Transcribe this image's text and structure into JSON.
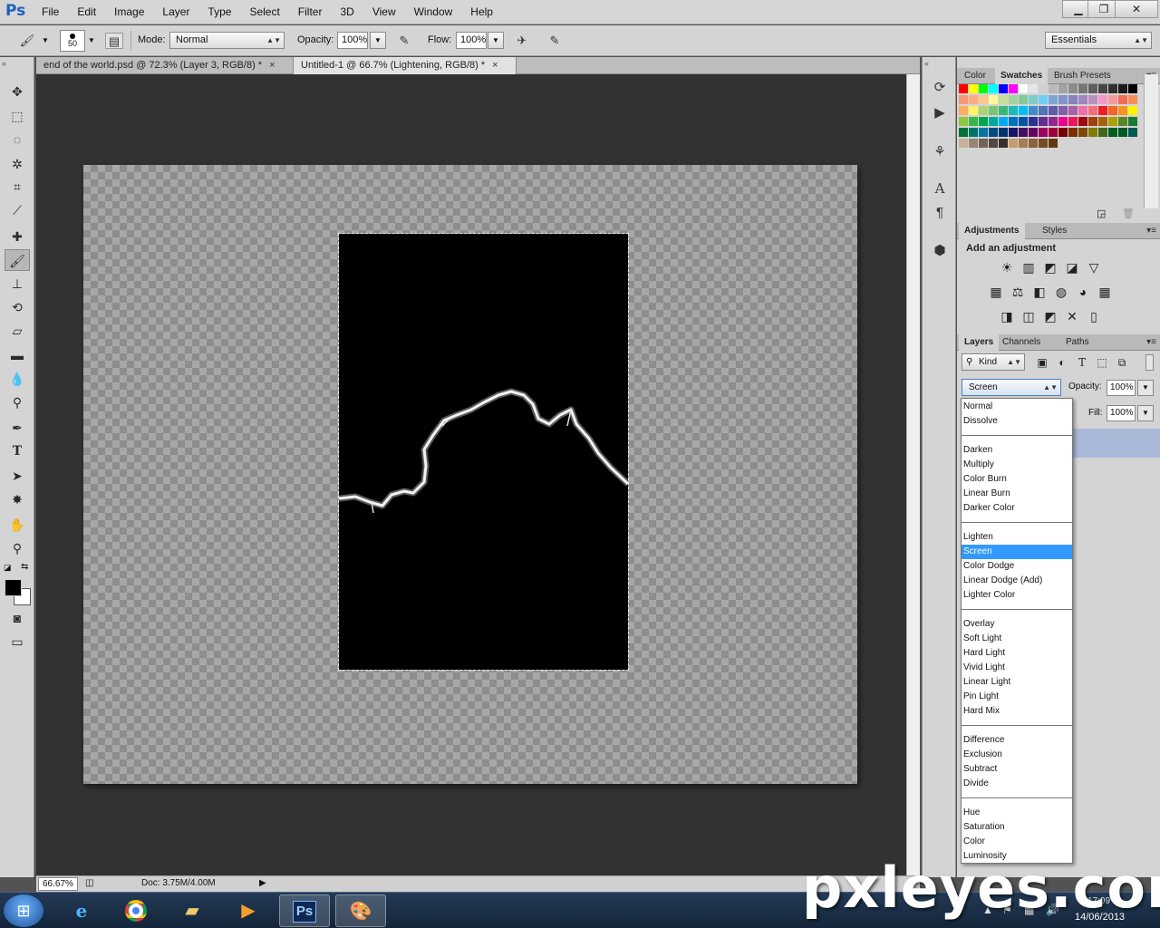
{
  "app": {
    "logo": "Ps"
  },
  "menu": [
    "File",
    "Edit",
    "Image",
    "Layer",
    "Type",
    "Select",
    "Filter",
    "3D",
    "View",
    "Window",
    "Help"
  ],
  "window_controls": {
    "minimize": "▁",
    "maximize": "❐",
    "close": "✕"
  },
  "options": {
    "brush_size": "50",
    "mode_label": "Mode:",
    "mode_value": "Normal",
    "opacity_label": "Opacity:",
    "opacity_value": "100%",
    "flow_label": "Flow:",
    "flow_value": "100%",
    "workspace": "Essentials"
  },
  "doc_tabs": [
    {
      "label": "end of the world.psd @ 72.3% (Layer 3, RGB/8) *",
      "close": "×"
    },
    {
      "label": "Untitled-1 @ 66.7% (Lightening, RGB/8) *",
      "close": "×"
    }
  ],
  "status": {
    "zoom": "66.67%",
    "doc": "Doc: 3.75M/4.00M"
  },
  "panels": {
    "color_tabs": [
      "Color",
      "Swatches",
      "Brush Presets"
    ],
    "adjust_tabs": [
      "Adjustments",
      "Styles"
    ],
    "adjust_title": "Add an adjustment",
    "layers_tabs": [
      "Layers",
      "Channels",
      "Paths"
    ],
    "kind": "Kind",
    "blend_value": "Screen",
    "opacity_label": "Opacity:",
    "opacity_value": "100%",
    "fill_label": "Fill:",
    "fill_value": "100%"
  },
  "swatch_rows": [
    [
      "#ff0000",
      "#ffff00",
      "#00ff00",
      "#00ffff",
      "#0000ff",
      "#ff00ff",
      "#ffffff",
      "#e6e6e6",
      "#d0d0d0",
      "#bababa",
      "#a3a3a3",
      "#8c8c8c",
      "#757575",
      "#5e5e5e",
      "#474747",
      "#303030",
      "#1a1a1a",
      "#000000"
    ],
    [
      "#f7977a",
      "#f9ad81",
      "#fdc68a",
      "#fff79a",
      "#c4df9b",
      "#a2d39c",
      "#82ca9d",
      "#7bcdc8",
      "#6ecff6",
      "#7ea7d8",
      "#8493ca",
      "#8882be",
      "#a187be",
      "#bc8dbf",
      "#f49ac2",
      "#f6989d",
      "#f26c4f",
      "#f68e56"
    ],
    [
      "#fbaf5c",
      "#fff467",
      "#acd372",
      "#7cc576",
      "#3bb878",
      "#1abbb4",
      "#00bff3",
      "#438cca",
      "#5574b9",
      "#605ca8",
      "#855fa8",
      "#a763a8",
      "#f06ea9",
      "#f26d7d",
      "#ed1c24",
      "#f26522",
      "#f7941d",
      "#fff200"
    ],
    [
      "#8dc73f",
      "#39b54a",
      "#00a651",
      "#00a99d",
      "#00aeef",
      "#0072bc",
      "#0054a6",
      "#2e3192",
      "#662d91",
      "#92278f",
      "#ec008c",
      "#ed145b",
      "#9e0b0f",
      "#a0410d",
      "#a36209",
      "#aba000",
      "#598527",
      "#197b30"
    ],
    [
      "#007236",
      "#00746b",
      "#0076a3",
      "#004b80",
      "#003471",
      "#1b1464",
      "#440e62",
      "#630460",
      "#9e005d",
      "#9e0039",
      "#790000",
      "#7b2e00",
      "#7d4900",
      "#827b00",
      "#406618",
      "#005e20",
      "#005826",
      "#005952"
    ],
    [
      "#c7b299",
      "#998675",
      "#736357",
      "#534741",
      "#37302d",
      "#c69c6d",
      "#a67c52",
      "#8c6239",
      "#754c24",
      "#603913"
    ]
  ],
  "adjust_icons": [
    [
      "☀",
      "▥",
      "◩",
      "◪",
      "▽"
    ],
    [
      "▦",
      "⚖",
      "◧",
      "◍",
      "◕",
      "▦"
    ],
    [
      "◨",
      "◫",
      "◩",
      "✕",
      "▯"
    ]
  ],
  "blend_modes": [
    [
      "Normal",
      "Dissolve"
    ],
    [
      "Darken",
      "Multiply",
      "Color Burn",
      "Linear Burn",
      "Darker Color"
    ],
    [
      "Lighten",
      "Screen",
      "Color Dodge",
      "Linear Dodge (Add)",
      "Lighter Color"
    ],
    [
      "Overlay",
      "Soft Light",
      "Hard Light",
      "Vivid Light",
      "Linear Light",
      "Pin Light",
      "Hard Mix"
    ],
    [
      "Difference",
      "Exclusion",
      "Subtract",
      "Divide"
    ],
    [
      "Hue",
      "Saturation",
      "Color",
      "Luminosity"
    ]
  ],
  "blend_selected": "Screen",
  "taskbar": {
    "time": "17:09",
    "date": "14/06/2013"
  },
  "watermark": "pxleyes.com"
}
